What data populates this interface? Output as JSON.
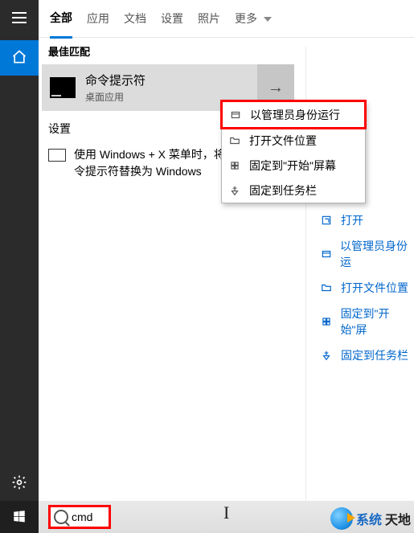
{
  "tabs": [
    "全部",
    "应用",
    "文档",
    "设置",
    "照片",
    "更多"
  ],
  "active_tab_index": 0,
  "best_match_label": "最佳匹配",
  "result": {
    "title": "命令提示符",
    "subtitle": "桌面应用"
  },
  "settings_label": "设置",
  "settings_item": "使用 Windows + X 菜单时，将命令提示符替换为 Windows",
  "context_menu": [
    "以管理员身份运行",
    "打开文件位置",
    "固定到\"开始\"屏幕",
    "固定到任务栏"
  ],
  "preview_actions": [
    "打开",
    "以管理员身份运",
    "打开文件位置",
    "固定到\"开始\"屏",
    "固定到任务栏"
  ],
  "search_value": "cmd",
  "watermark": {
    "a": "系统",
    "b": "天地"
  }
}
